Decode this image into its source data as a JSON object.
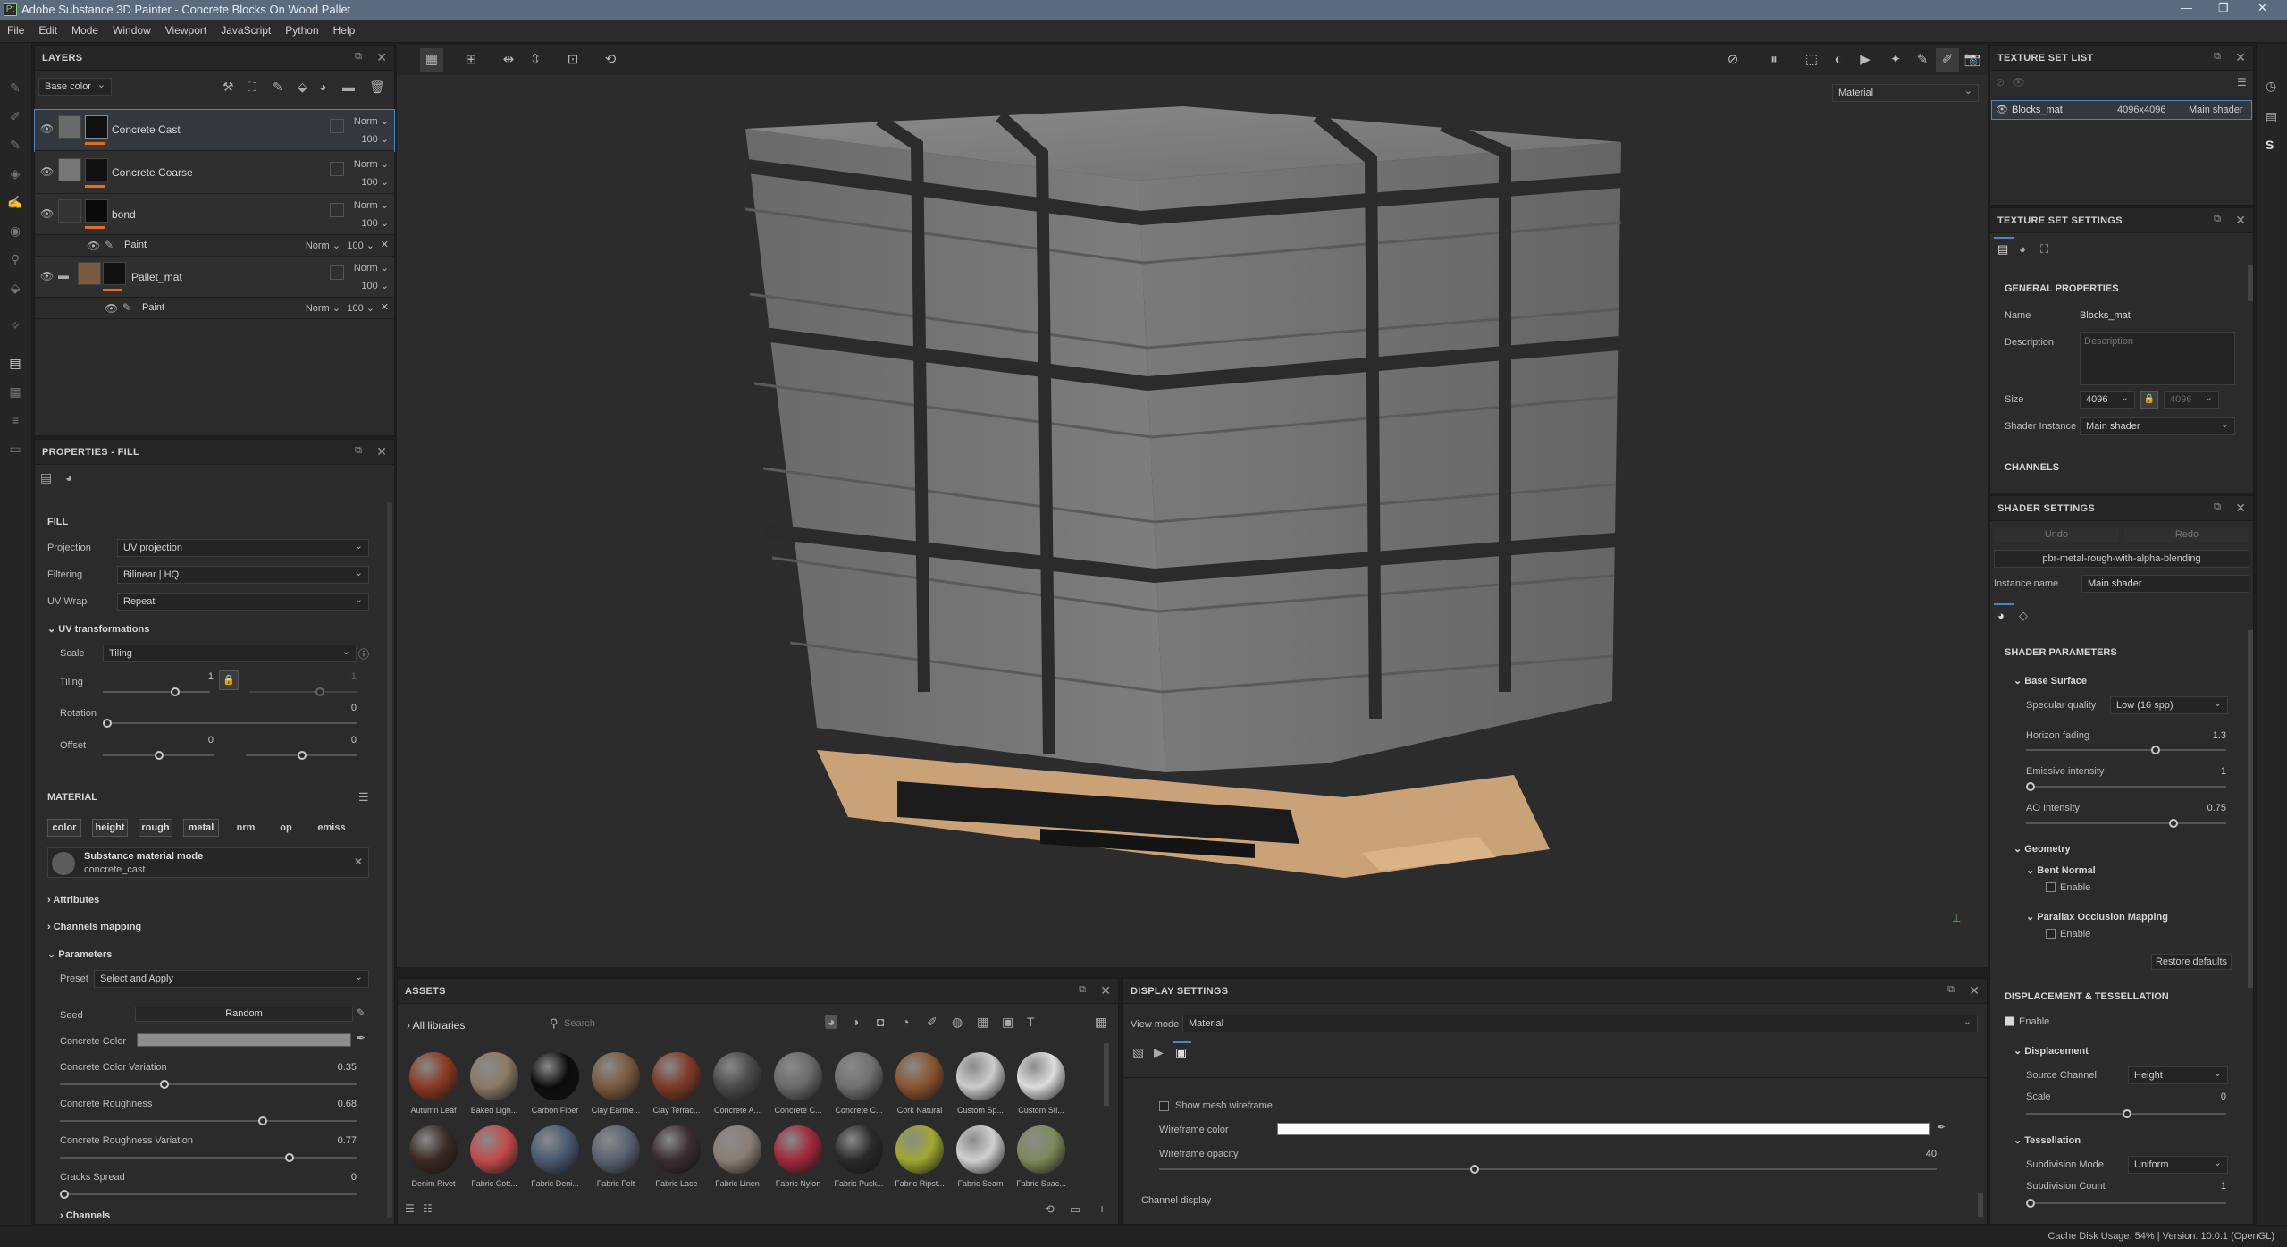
{
  "titlebar": {
    "title": "Adobe Substance 3D Painter - Concrete Blocks On Wood Pallet"
  },
  "menu": [
    "File",
    "Edit",
    "Mode",
    "Window",
    "Viewport",
    "JavaScript",
    "Python",
    "Help"
  ],
  "layers": {
    "title": "LAYERS",
    "channel": "Base color",
    "items": [
      {
        "name": "Concrete Cast",
        "blend": "Norm",
        "opacity": "100"
      },
      {
        "name": "Concrete Coarse",
        "blend": "Norm",
        "opacity": "100"
      },
      {
        "name": "bond",
        "blend": "Norm",
        "opacity": "100"
      },
      {
        "name": "Paint",
        "blend": "Norm",
        "opacity": "100"
      },
      {
        "name": "Pallet_mat",
        "blend": "Norm",
        "opacity": "100"
      },
      {
        "name": "Paint",
        "blend": "Norm",
        "opacity": "100"
      }
    ]
  },
  "properties": {
    "title": "PROPERTIES - FILL",
    "fill_section": "FILL",
    "projection_label": "Projection",
    "projection": "UV projection",
    "filtering_label": "Filtering",
    "filtering": "Bilinear | HQ",
    "uvwrap_label": "UV Wrap",
    "uvwrap": "Repeat",
    "uvtrans": "UV transformations",
    "scale_label": "Scale",
    "scale": "Tiling",
    "tiling_label": "Tiling",
    "tiling_a": "1",
    "tiling_b": "1",
    "rotation_label": "Rotation",
    "rotation": "0",
    "offset_label": "Offset",
    "offset_a": "0",
    "offset_b": "0",
    "material_section": "MATERIAL",
    "chips": [
      "color",
      "height",
      "rough",
      "metal",
      "nrm",
      "op",
      "emiss"
    ],
    "submat_title": "Substance material mode",
    "submat_name": "concrete_cast",
    "attributes": "Attributes",
    "channels_mapping": "Channels mapping",
    "parameters": "Parameters",
    "preset_label": "Preset",
    "preset": "Select and Apply",
    "seed_label": "Seed",
    "seed": "Random",
    "cc_label": "Concrete Color",
    "ccv_label": "Concrete Color Variation",
    "ccv": "0.35",
    "cr_label": "Concrete Roughness",
    "cr": "0.68",
    "crv_label": "Concrete Roughness Variation",
    "crv": "0.77",
    "cs_label": "Cracks Spread",
    "cs": "0",
    "channels": "Channels"
  },
  "viewport": {
    "mode": "Material"
  },
  "texture_set_list": {
    "title": "TEXTURE SET LIST",
    "name": "Blocks_mat",
    "size": "4096x4096",
    "shader": "Main shader"
  },
  "texture_set_settings": {
    "title": "TEXTURE SET SETTINGS",
    "general": "GENERAL PROPERTIES",
    "name_label": "Name",
    "name": "Blocks_mat",
    "desc_label": "Description",
    "desc_placeholder": "Description",
    "size_label": "Size",
    "size_a": "4096",
    "size_b": "4096",
    "shader_label": "Shader Instance",
    "shader": "Main shader",
    "channels": "CHANNELS"
  },
  "shader_settings": {
    "title": "SHADER SETTINGS",
    "undo": "Undo",
    "redo": "Redo",
    "shader_file": "pbr-metal-rough-with-alpha-blending",
    "instance_label": "Instance name",
    "instance": "Main shader",
    "params": "SHADER PARAMETERS",
    "base_surface": "Base Surface",
    "spec_label": "Specular quality",
    "spec": "Low (16 spp)",
    "horizon_label": "Horizon fading",
    "horizon": "1.3",
    "emissive_label": "Emissive intensity",
    "emissive": "1",
    "ao_label": "AO Intensity",
    "ao": "0.75",
    "geometry": "Geometry",
    "bent": "Bent Normal",
    "bent_enable": "Enable",
    "pom": "Parallax Occlusion Mapping",
    "pom_enable": "Enable",
    "restore": "Restore defaults",
    "disp_tess": "DISPLACEMENT & TESSELLATION",
    "dt_enable": "Enable",
    "displacement": "Displacement",
    "source_label": "Source Channel",
    "source": "Height",
    "scale_label": "Scale",
    "scale": "0",
    "tessellation": "Tessellation",
    "subdiv_mode_label": "Subdivision Mode",
    "subdiv_mode": "Uniform",
    "subdiv_count_label": "Subdivision Count",
    "subdiv_count": "1"
  },
  "assets": {
    "title": "ASSETS",
    "libraries": "All libraries",
    "search_placeholder": "Search",
    "items": [
      {
        "name": "Autumn Leaf",
        "color": "#8a3a22"
      },
      {
        "name": "Baked Ligh...",
        "color": "#8a7a66"
      },
      {
        "name": "Carbon Fiber",
        "color": "#0c0c0c"
      },
      {
        "name": "Clay Earthe...",
        "color": "#7a5a3e"
      },
      {
        "name": "Clay Terrac...",
        "color": "#7e3a26"
      },
      {
        "name": "Concrete A...",
        "color": "#4a4a4a"
      },
      {
        "name": "Concrete C...",
        "color": "#6a6a6a"
      },
      {
        "name": "Concrete C...",
        "color": "#707070"
      },
      {
        "name": "Cork Natural",
        "color": "#8a5430"
      },
      {
        "name": "Custom Sp...",
        "color": "#cccccc"
      },
      {
        "name": "Custom Sti...",
        "color": "#dddddd"
      },
      {
        "name": "Denim Rivet",
        "color": "#3a2a22"
      },
      {
        "name": "Fabric Cott...",
        "color": "#c24a4a"
      },
      {
        "name": "Fabric Deni...",
        "color": "#4a5a72"
      },
      {
        "name": "Fabric Felt",
        "color": "#5a6272"
      },
      {
        "name": "Fabric Lace",
        "color": "#3a2c30"
      },
      {
        "name": "Fabric Linen",
        "color": "#8a7e74"
      },
      {
        "name": "Fabric Nylon",
        "color": "#a0283a"
      },
      {
        "name": "Fabric Puck...",
        "color": "#2a2a2a"
      },
      {
        "name": "Fabric Ripst...",
        "color": "#a0a830"
      },
      {
        "name": "Fabric Seam",
        "color": "#d0d0d0"
      },
      {
        "name": "Fabric Spac...",
        "color": "#7e8a5a"
      }
    ]
  },
  "display_settings": {
    "title": "DISPLAY SETTINGS",
    "view_label": "View mode",
    "view": "Material",
    "wire_show": "Show mesh wireframe",
    "wire_color": "Wireframe color",
    "wire_opacity_label": "Wireframe opacity",
    "wire_opacity": "40",
    "channel_display": "Channel display"
  },
  "status": {
    "text": "Cache Disk Usage:   54% | Version: 10.0.1 (OpenGL)"
  }
}
